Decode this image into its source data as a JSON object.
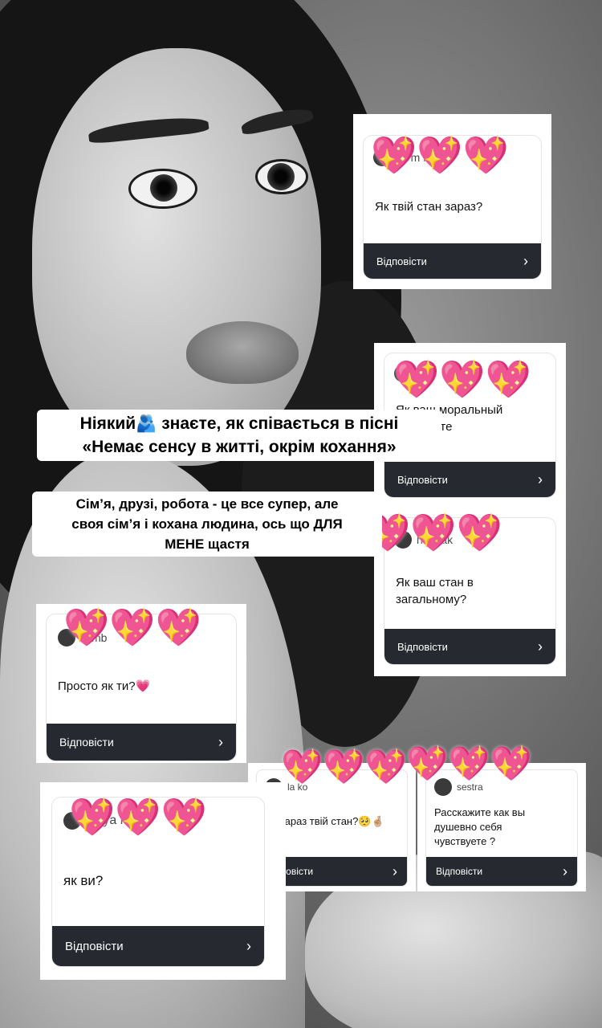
{
  "cards": [
    {
      "handle": "co       m     nko",
      "question": "Як твій стан зараз?",
      "reply": "Відповісти"
    },
    {
      "handle": "            s",
      "question_l1": "Як ваш моральный",
      "question_l2": "почуваете",
      "reply": "Відповісти"
    },
    {
      "handle": "        ha.     yak",
      "question": "Як ваш стан в загальному?",
      "reply": "Відповісти"
    },
    {
      "handle": "       lk      mb",
      "question": "Просто як ти?💗",
      "reply": "Відповісти"
    },
    {
      "handle": "       la       ko",
      "question": "Як зараз твій стан?🥺🤞🏼",
      "reply": "Відповісти"
    },
    {
      "handle": "      sestra",
      "question": "Расскажите как вы душевно себя чувствуете ?",
      "reply": "Відповісти"
    },
    {
      "handle": "  Jb      ya    kk",
      "question": "як ви?",
      "reply": "Відповісти"
    }
  ],
  "heart_emoji": "💖",
  "caption1": {
    "line1": "Ніякий🫂 знаєте, як співається в пісні",
    "line2": "«Немає сенсу в житті, окрім кохання»"
  },
  "caption2": {
    "line1": "Сім’я, друзі, робота - це все супер, але",
    "line2": "своя сім’я і кохана людина, ось що ДЛЯ",
    "line3": "МЕНЕ щастя"
  },
  "chevron": "›"
}
